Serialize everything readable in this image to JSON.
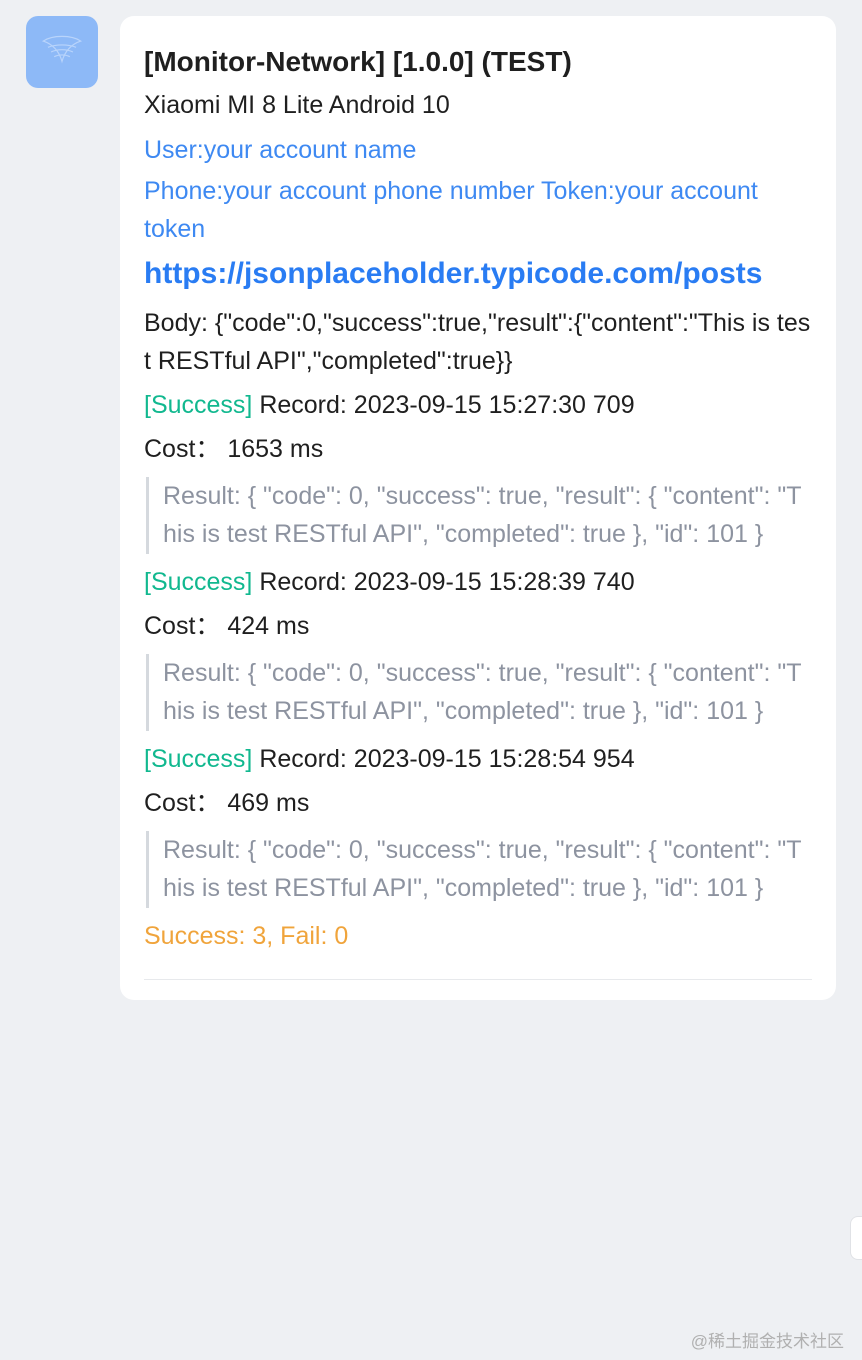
{
  "header": {
    "title": "[Monitor-Network] [1.0.0] (TEST)",
    "device": "Xiaomi MI 8 Lite Android 10",
    "user_line": "User:your account name",
    "phone_token_line": "Phone:your account phone number Token:your account token",
    "url": "https://jsonplaceholder.typicode.com/posts",
    "body": "Body: {\"code\":0,\"success\":true,\"result\":{\"content\":\"This is test RESTful API\",\"completed\":true}}"
  },
  "records": [
    {
      "status_tag": "[Success]",
      "record": " Record: 2023-09-15 15:27:30 709",
      "cost": "Cost： 1653 ms",
      "result": "Result: { \"code\": 0, \"success\": true, \"result\": { \"content\": \"This is test RESTful API\", \"completed\": true }, \"id\": 101 }"
    },
    {
      "status_tag": "[Success]",
      "record": " Record: 2023-09-15 15:28:39 740",
      "cost": "Cost： 424 ms",
      "result": "Result: { \"code\": 0, \"success\": true, \"result\": { \"content\": \"This is test RESTful API\", \"completed\": true }, \"id\": 101 }"
    },
    {
      "status_tag": "[Success]",
      "record": " Record: 2023-09-15 15:28:54 954",
      "cost": "Cost： 469 ms",
      "result": "Result: { \"code\": 0, \"success\": true, \"result\": { \"content\": \"This is test RESTful API\", \"completed\": true }, \"id\": 101 }"
    }
  ],
  "summary": "Success: 3, Fail: 0",
  "watermark": "@稀土掘金技术社区"
}
